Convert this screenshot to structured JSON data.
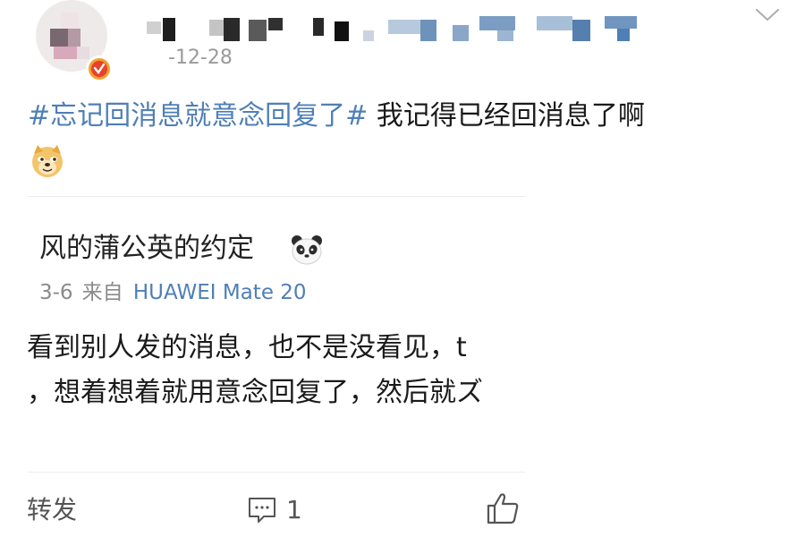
{
  "post": {
    "time": "-12-28",
    "hashtag": "#忘记回消息就意念回复了#",
    "text": " 我记得已经回消息了啊"
  },
  "reply": {
    "author": "风的蒲公英的约定",
    "date": "3-6",
    "from_label": "来自",
    "device": "HUAWEI Mate 20",
    "lines": [
      "看到别人发的消息，也不是没看见，t",
      "，想着想着就用意念回复了，然后就ズ"
    ]
  },
  "actions": {
    "repost_label": "转发",
    "comment_count": "1"
  },
  "icons": {
    "more": "chevron-down-icon",
    "verify": "verified-badge-icon",
    "doge": "doge-emoji",
    "panda": "panda-emoji",
    "comment": "comment-icon",
    "like": "thumbs-up-icon"
  },
  "colors": {
    "link": "#4f7fb6",
    "text": "#1a1a1a",
    "muted": "#8a8a8a",
    "badge": "#e8412c"
  }
}
